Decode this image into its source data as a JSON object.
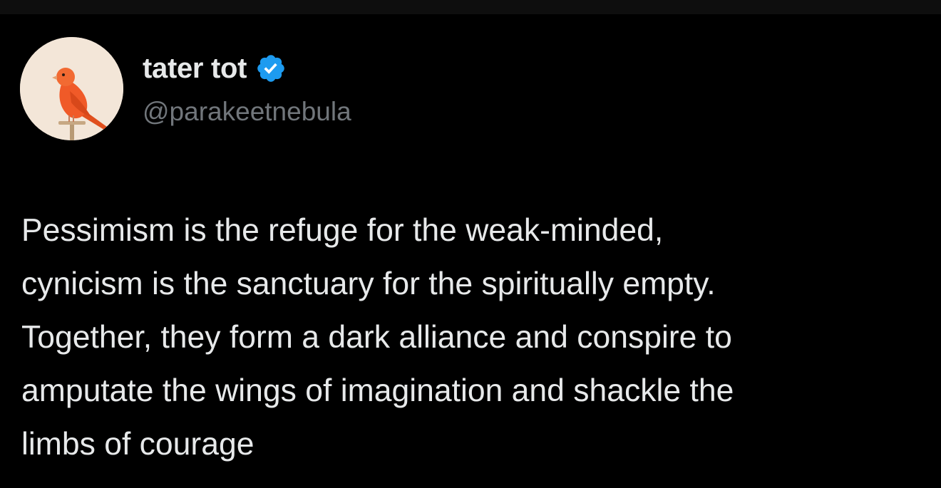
{
  "author": {
    "display_name": "tater tot",
    "handle": "@parakeetnebula",
    "verified": true,
    "verified_icon": "verified-badge-icon",
    "avatar": "orange-canary-on-perch"
  },
  "tweet": {
    "lines": [
      "Pessimism is the refuge for the weak-minded,",
      "cynicism is the sanctuary for the spiritually empty.",
      "Together, they form a dark alliance and conspire to",
      "amputate the wings of imagination and shackle the",
      "limbs of courage"
    ]
  },
  "colors": {
    "background": "#000000",
    "primary_text": "#e7e9ea",
    "secondary_text": "#71767b",
    "verified_blue": "#1d9bf0",
    "avatar_background": "#f3e6d8",
    "bird_orange": "#f05a28"
  }
}
